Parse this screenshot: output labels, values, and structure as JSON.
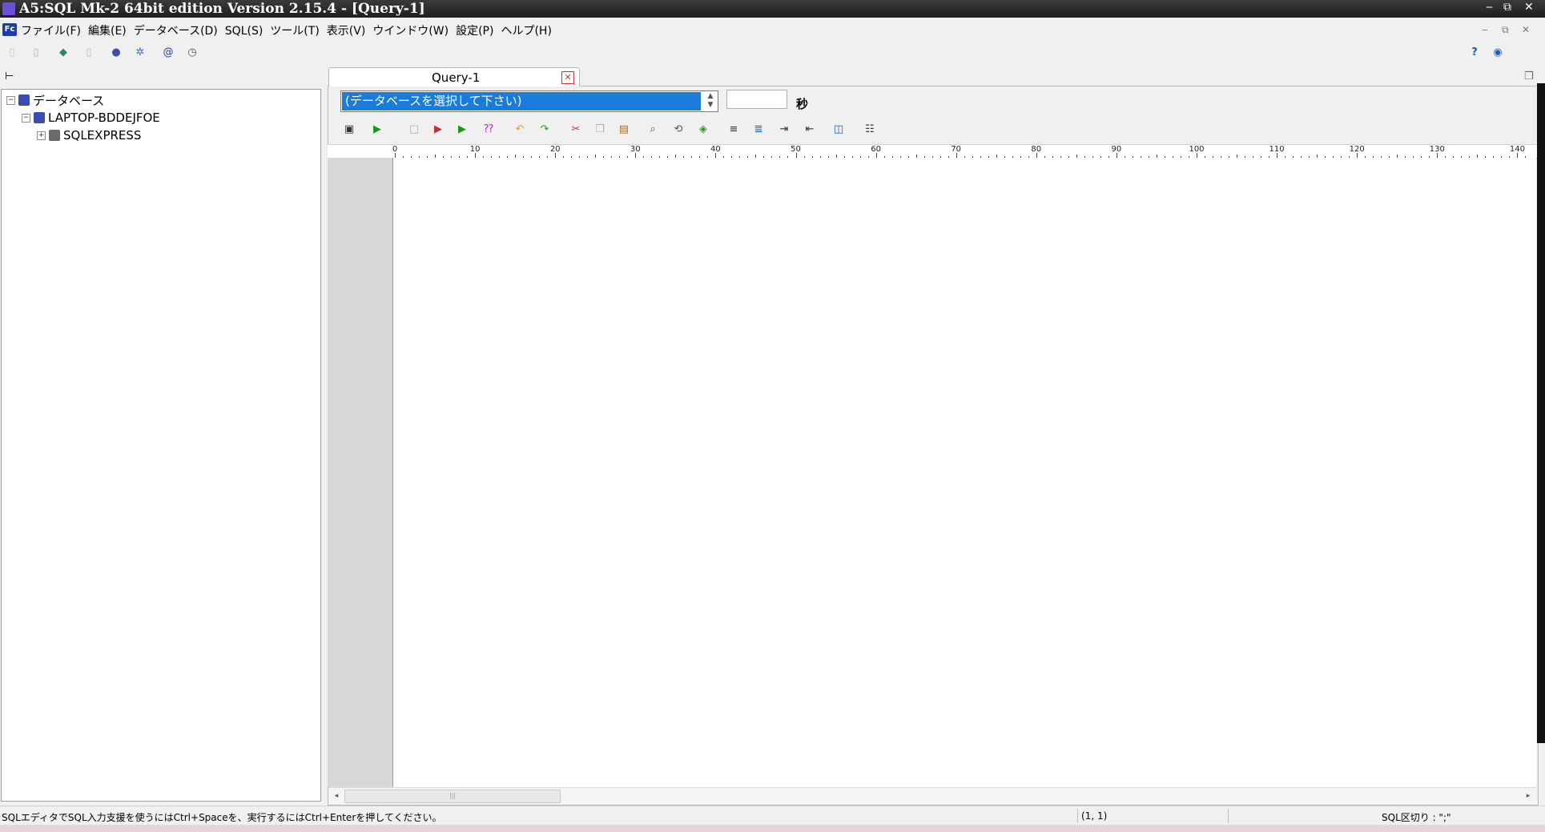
{
  "window": {
    "title": "A5:SQL Mk-2 64bit edition Version 2.15.4 - [Query-1]",
    "minimize": "‒",
    "restore": "⧉",
    "close": "✕"
  },
  "menu": {
    "app_icon": "Fc",
    "items": [
      "ファイル(F)",
      "編集(E)",
      "データベース(D)",
      "SQL(S)",
      "ツール(T)",
      "表示(V)",
      "ウインドウ(W)",
      "設定(P)",
      "ヘルプ(H)"
    ],
    "mdi_min": "‒",
    "mdi_restore": "⧉",
    "mdi_close": "✕"
  },
  "main_toolbar": {
    "icons": [
      {
        "name": "new-file-icon",
        "glyph": "▯",
        "color": "#c8c8c8"
      },
      {
        "name": "open-file-icon",
        "glyph": "▯",
        "color": "#b0b0b0"
      },
      {
        "name": "connect-icon",
        "glyph": "◆",
        "color": "#2e8b57"
      },
      {
        "name": "disconnect-icon",
        "glyph": "▯",
        "color": "#b8b8b8"
      },
      {
        "name": "database-icon",
        "glyph": "●",
        "color": "#3b4db0"
      },
      {
        "name": "settings-icon",
        "glyph": "✲",
        "color": "#3b6fd0"
      },
      {
        "name": "at-icon",
        "glyph": "@",
        "color": "#2a3a9a"
      },
      {
        "name": "clock-icon",
        "glyph": "◷",
        "color": "#555555"
      }
    ],
    "help_icons": [
      {
        "name": "help-icon",
        "glyph": "?",
        "color": "#1a5fc0"
      },
      {
        "name": "globe-icon",
        "glyph": "◉",
        "color": "#1a5fc0"
      }
    ]
  },
  "tree": {
    "header_icon": "tree-toggle-icon",
    "nodes": [
      {
        "label": "データベース",
        "expander": "−",
        "icon_color": "#3b4db0"
      },
      {
        "label": "LAPTOP-BDDEJFOE",
        "expander": "−",
        "icon_color": "#3b4db0"
      },
      {
        "label": "SQLEXPRESS",
        "expander": "+",
        "icon_color": "#6a6a6a"
      }
    ]
  },
  "tabs": [
    {
      "label": "Query-1",
      "close": "✕"
    }
  ],
  "query": {
    "database_select": "(データベースを選択して下さい)",
    "timeout_value": "",
    "timeout_unit": "秒",
    "editor_text": ""
  },
  "editor_toolbar": {
    "icons": [
      {
        "name": "save-icon",
        "glyph": "▣",
        "color": "#333333"
      },
      {
        "name": "run-icon",
        "glyph": "▶",
        "color": "#1a9a1a"
      },
      {
        "name": "stop-icon",
        "glyph": "□",
        "color": "#b0b0b0"
      },
      {
        "name": "run-to-excel-icon",
        "glyph": "▶",
        "color": "#c03030"
      },
      {
        "name": "run-to-csv-icon",
        "glyph": "▶",
        "color": "#1a9a1a"
      },
      {
        "name": "explain-icon",
        "glyph": "⁇",
        "color": "#b030c0"
      },
      {
        "name": "undo-icon",
        "glyph": "↶",
        "color": "#e0a020"
      },
      {
        "name": "redo-icon",
        "glyph": "↷",
        "color": "#2a9a2a"
      },
      {
        "name": "cut-icon",
        "glyph": "✂",
        "color": "#cc3030"
      },
      {
        "name": "copy-icon",
        "glyph": "❐",
        "color": "#b0b0b0"
      },
      {
        "name": "paste-icon",
        "glyph": "▤",
        "color": "#a07030"
      },
      {
        "name": "find-icon",
        "glyph": "⌕",
        "color": "#555555"
      },
      {
        "name": "replace-icon",
        "glyph": "⟲",
        "color": "#555555"
      },
      {
        "name": "format-sql-icon",
        "glyph": "◈",
        "color": "#2a9a2a"
      },
      {
        "name": "align-icon",
        "glyph": "≡",
        "color": "#333333"
      },
      {
        "name": "comment-icon",
        "glyph": "≣",
        "color": "#1a5fc0"
      },
      {
        "name": "indent-icon",
        "glyph": "⇥",
        "color": "#333333"
      },
      {
        "name": "outdent-icon",
        "glyph": "⇤",
        "color": "#333333"
      },
      {
        "name": "compare-icon",
        "glyph": "◫",
        "color": "#1a5fc0"
      },
      {
        "name": "outline-icon",
        "glyph": "☷",
        "color": "#333333"
      }
    ]
  },
  "ruler": {
    "labels": [
      "0",
      "10",
      "20",
      "30",
      "40",
      "50",
      "60",
      "70",
      "80",
      "90",
      "100",
      "110",
      "120",
      "130",
      "140"
    ]
  },
  "status": {
    "hint": "SQLエディタでSQL入力支援を使うにはCtrl+Spaceを、実行するにはCtrl+Enterを押してください。",
    "cursor": "(1, 1)",
    "delimiter": "SQL区切り : \";\""
  }
}
